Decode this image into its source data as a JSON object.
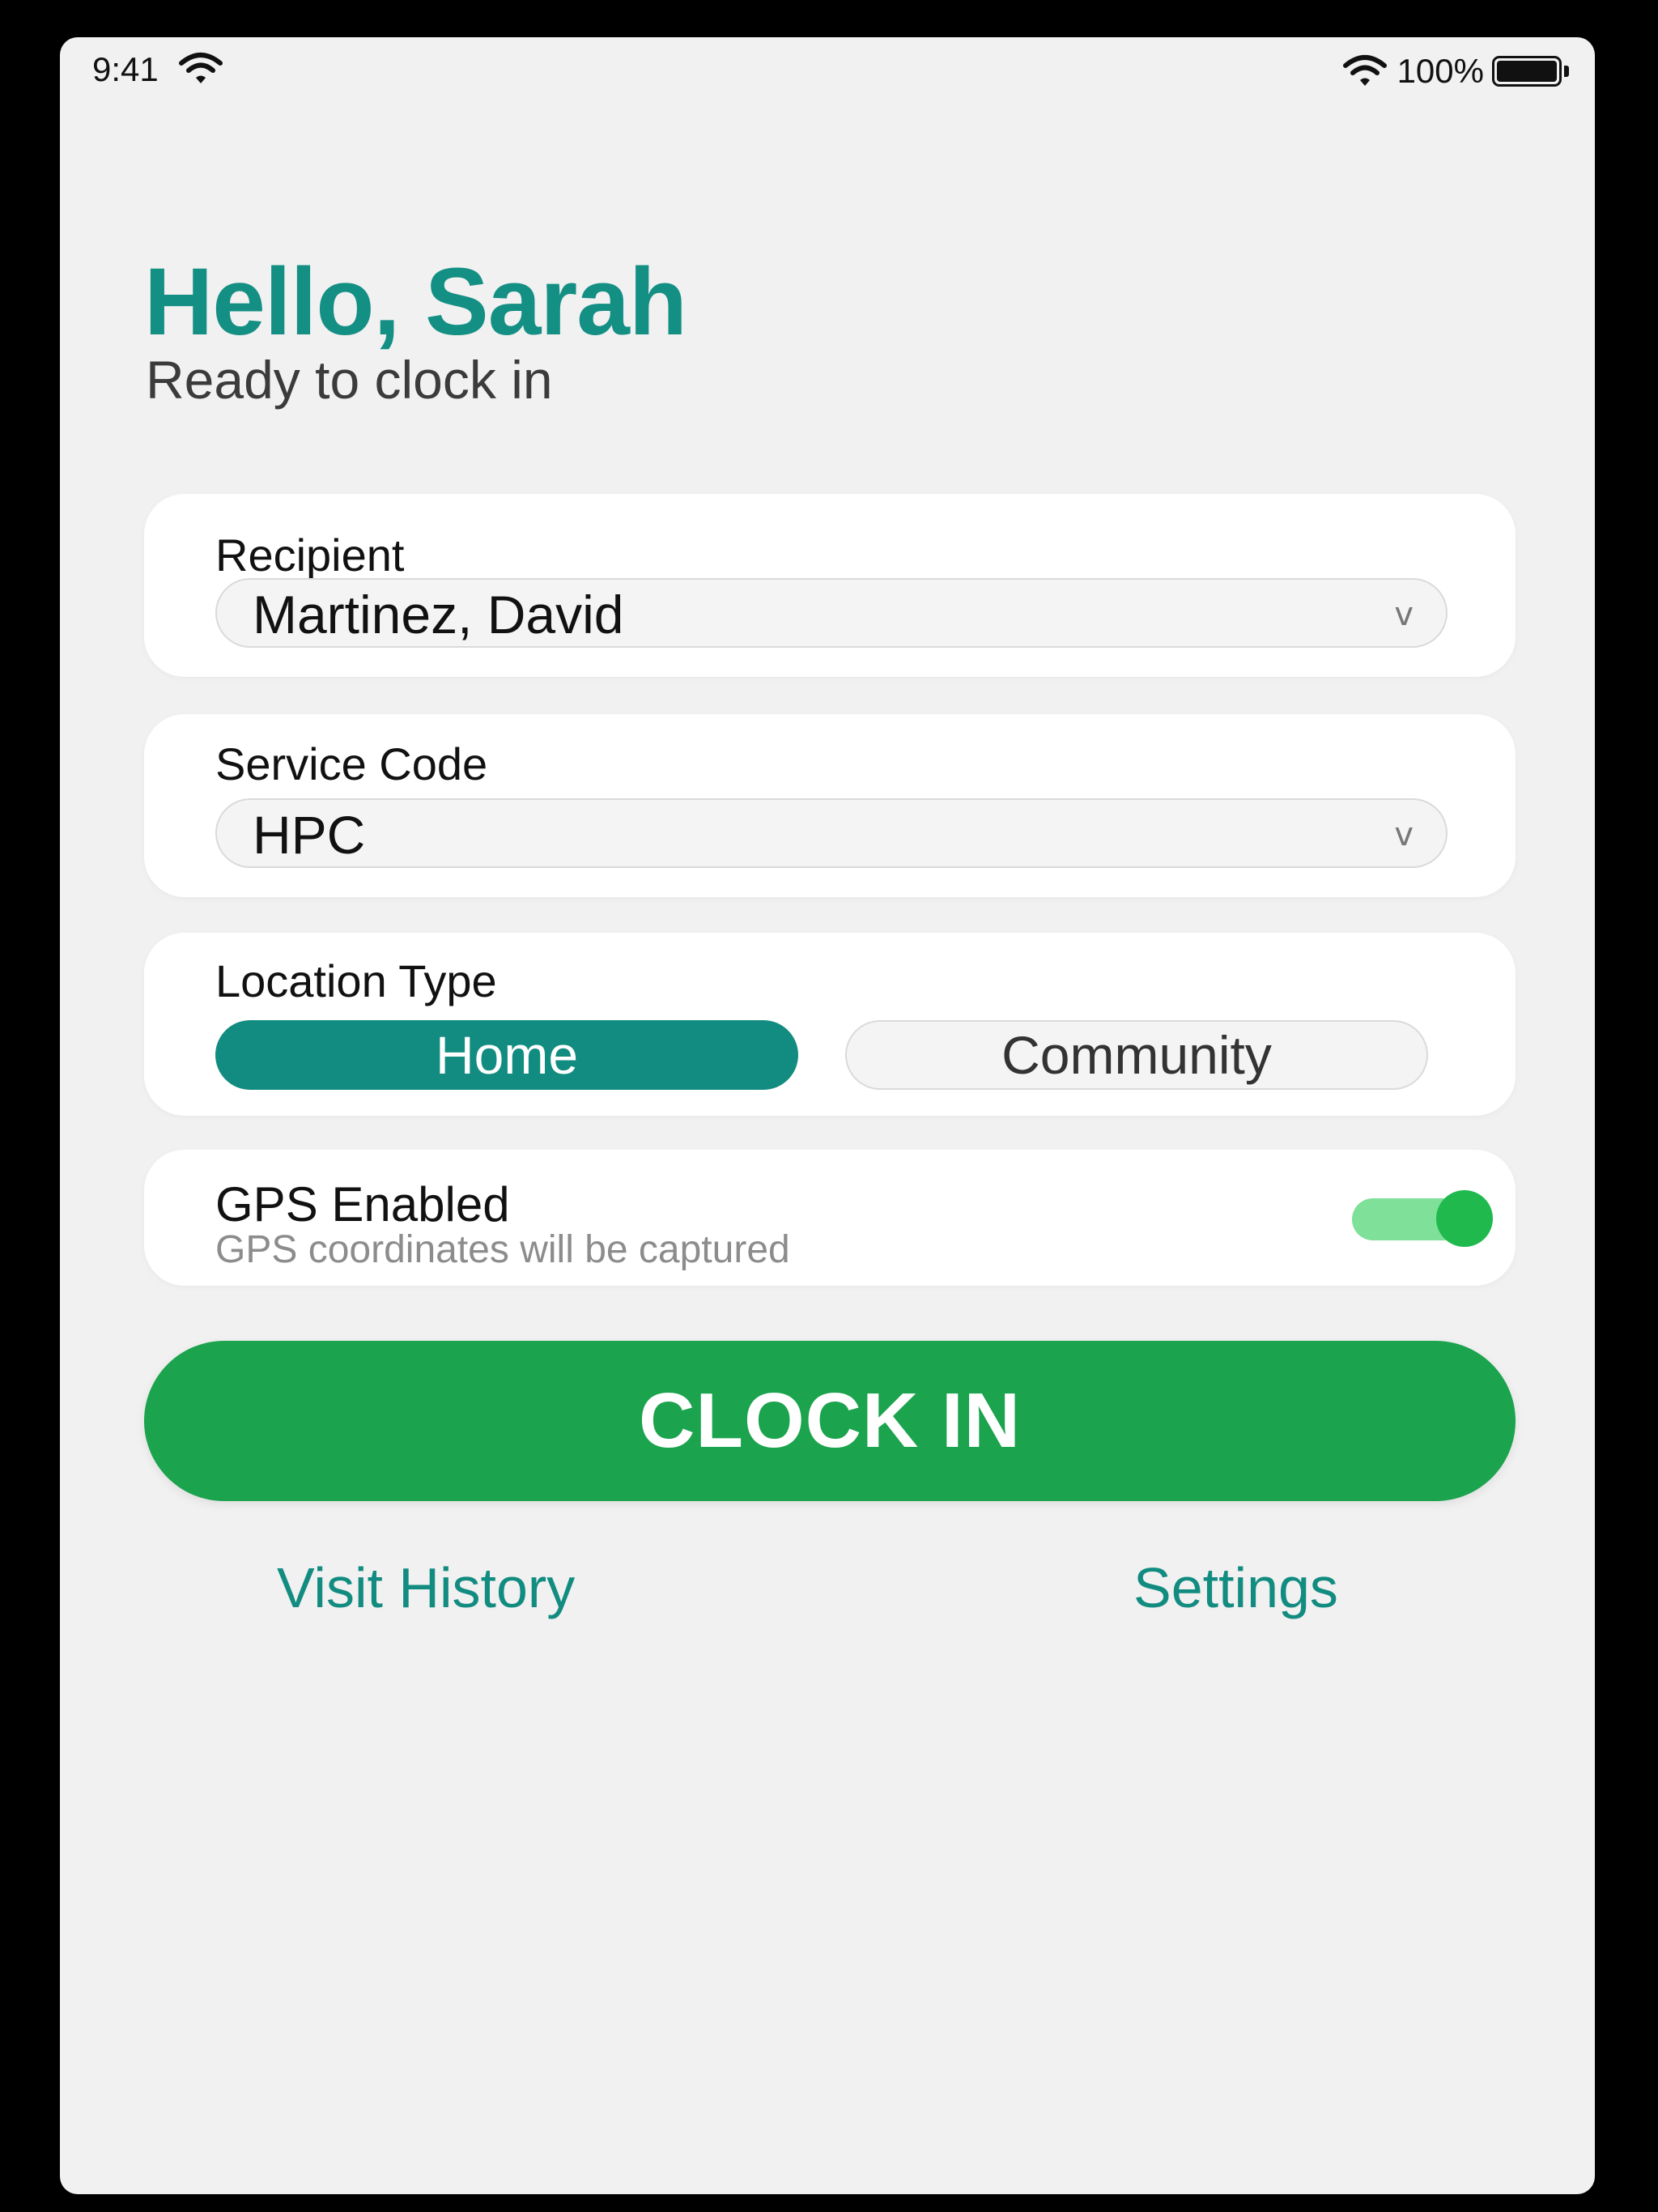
{
  "status_bar": {
    "time": "9:41",
    "battery_percent": "100%",
    "battery_level": 1.0
  },
  "header": {
    "greeting": "Hello, Sarah",
    "subtitle": "Ready to clock in"
  },
  "form": {
    "recipient": {
      "label": "Recipient",
      "value": "Martinez, David"
    },
    "service_code": {
      "label": "Service Code",
      "value": "HPC"
    },
    "location_type": {
      "label": "Location Type",
      "options": [
        "Home",
        "Community"
      ],
      "selected": "Home"
    },
    "gps": {
      "title": "GPS Enabled",
      "description": "GPS coordinates will be captured",
      "enabled": true
    }
  },
  "actions": {
    "clock_in_label": "CLOCK IN",
    "visit_history_label": "Visit History",
    "settings_label": "Settings"
  },
  "colors": {
    "brand_teal": "#138f84",
    "clock_in_green": "#1ba34d",
    "toggle_on": "#1fb94d"
  }
}
